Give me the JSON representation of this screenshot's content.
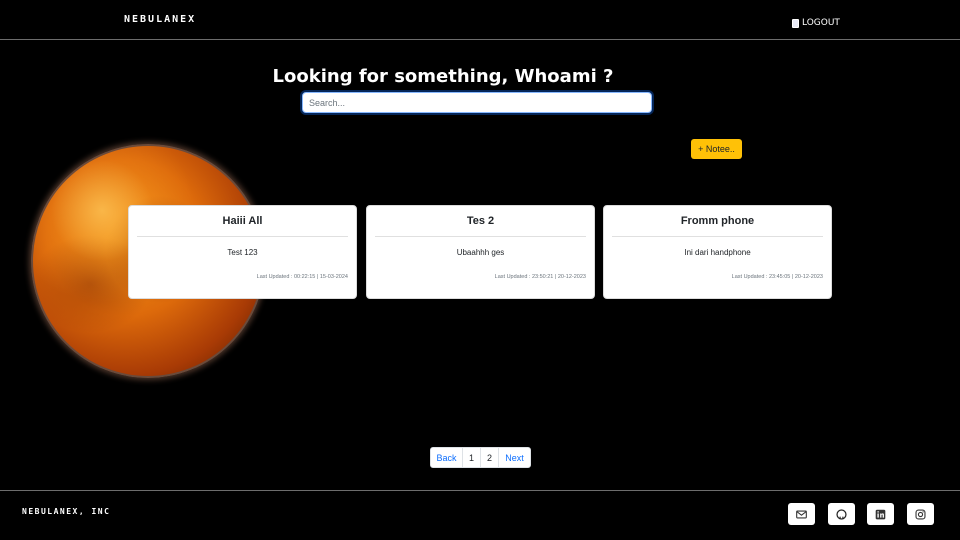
{
  "header": {
    "brand": "NEBULANEX",
    "logout_label": "LOGOUT"
  },
  "main": {
    "headline": "Looking for something, Whoami ?",
    "search_placeholder": "Search...",
    "add_note_label": "+ Notee.."
  },
  "notes": [
    {
      "title": "Haiii All",
      "body": "Test 123",
      "updated": "Last Updated : 00:22:15 | 15-03-2024"
    },
    {
      "title": "Tes 2",
      "body": "Ubaahhh ges",
      "updated": "Last Updated : 23:50:21 | 20-12-2023"
    },
    {
      "title": "Fromm phone",
      "body": "Ini dari handphone",
      "updated": "Last Updated : 23:45:05 | 20-12-2023"
    }
  ],
  "pagination": {
    "back_label": "Back",
    "pages": [
      "1",
      "2"
    ],
    "next_label": "Next"
  },
  "footer": {
    "brand": "NEBULANEX, INC",
    "social_icons": [
      "email-icon",
      "github-icon",
      "linkedin-icon",
      "instagram-icon"
    ]
  },
  "colors": {
    "background": "#000000",
    "accent_yellow": "#ffc107",
    "link_blue": "#0d6efd",
    "card_bg": "#ffffff"
  }
}
